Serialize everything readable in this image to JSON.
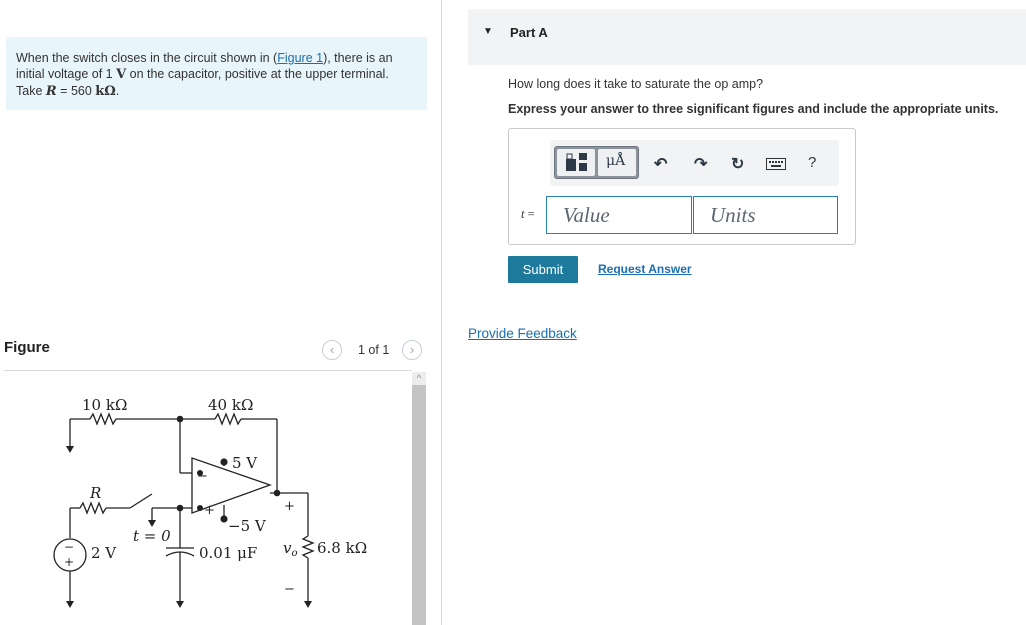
{
  "problem": {
    "text_1": "When the switch closes in the circuit shown in (",
    "figure_link": "Figure 1",
    "text_2": "), there is an",
    "text_3": "initial voltage of 1 ",
    "volt_unit": "V",
    "text_4": " on the capacitor, positive at the upper terminal.",
    "text_5": "Take ",
    "r_symbol": "R",
    "r_value": " = 560 ",
    "r_unit": "kΩ",
    "text_6": "."
  },
  "figure": {
    "label": "Figure",
    "pager_text": "1 of 1",
    "prev_icon": "chevron-left-icon",
    "next_icon": "chevron-right-icon"
  },
  "circuit": {
    "r1": "10 kΩ",
    "r2": "40 kΩ",
    "vpos": "5 V",
    "vneg": "−5 V",
    "r": "R",
    "switch": "t = 0",
    "source": "2 V",
    "cap": "0.01 μF",
    "vo": "v",
    "vo_sub": "o",
    "load": "6.8 kΩ",
    "minus": "−",
    "plus": "+"
  },
  "part": {
    "title": "Part A",
    "question": "How long does it take to saturate the op amp?",
    "instruction": "Express your answer to three significant figures and include the appropriate units.",
    "variable": "t",
    "equals": " =",
    "value_placeholder": "Value",
    "units_placeholder": "Units",
    "toolbar": {
      "units_symbol": "μÅ",
      "help": "?"
    },
    "submit": "Submit",
    "request_answer": "Request Answer"
  },
  "feedback": "Provide Feedback",
  "colors": {
    "problem_bg": "#e8f5fa",
    "link": "#1a6fb0",
    "submit_bg": "#1e7a9c",
    "input_border": "#2a7fb8"
  }
}
